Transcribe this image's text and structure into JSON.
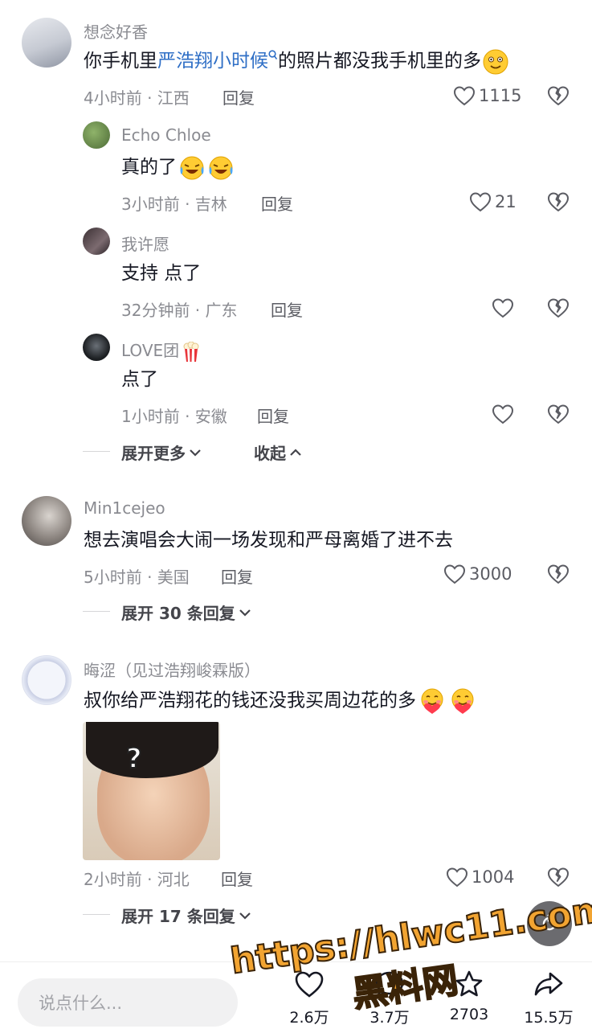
{
  "comments": [
    {
      "name": "想念好香",
      "text_pre": "你手机里",
      "text_link": "严浩翔小时候",
      "text_post": "的照片都没我手机里的多",
      "meta": "4小时前 · 江西",
      "reply": "回复",
      "likes": "1115",
      "replies": [
        {
          "name": "Echo Chloe",
          "text": "真的了",
          "meta": "3小时前 · 吉林",
          "reply": "回复",
          "likes": "21"
        },
        {
          "name": "我许愿",
          "text": "支持 点了",
          "meta": "32分钟前 · 广东",
          "reply": "回复",
          "likes": ""
        },
        {
          "name": "LOVE团",
          "text": "点了",
          "meta": "1小时前 · 安徽",
          "reply": "回复",
          "likes": ""
        }
      ],
      "expand_more": "展开更多",
      "collapse": "收起"
    },
    {
      "name": "Min1cejeo",
      "text": "想去演唱会大闹一场发现和严母离婚了进不去",
      "meta": "5小时前 · 美国",
      "reply": "回复",
      "likes": "3000",
      "expand": "展开 30 条回复"
    },
    {
      "name": "晦涩（见过浩翔峻霖版）",
      "text": "叔你给严浩翔花的钱还没我买周边花的多",
      "meta": "2小时前 · 河北",
      "reply": "回复",
      "likes": "1004",
      "expand": "展开 17 条回复",
      "image_label": "?"
    }
  ],
  "bottom": {
    "input_placeholder": "说点什么...",
    "likes": "2.6万",
    "comments": "3.7万",
    "favorites": "2703",
    "shares": "15.5万"
  },
  "watermark": {
    "line1": "https://hlwc11.com",
    "line2": "黑料网"
  },
  "colors": {
    "link": "#2f6fc6",
    "text": "#161823",
    "muted": "#8a8b91",
    "watermark": "#f2a431"
  }
}
